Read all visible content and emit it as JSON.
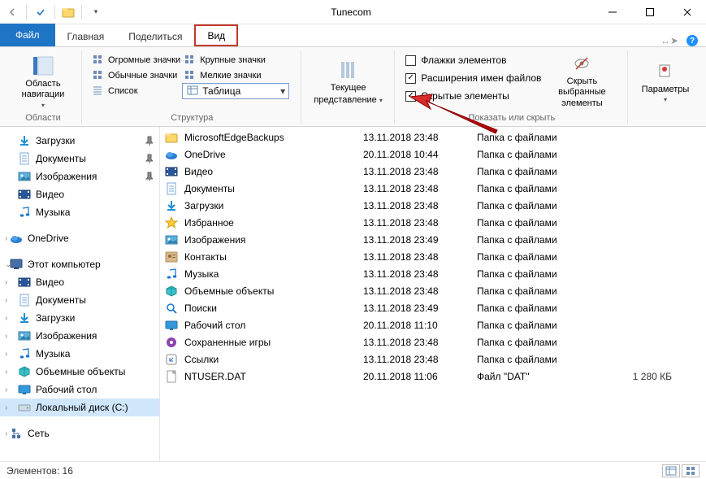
{
  "title": "Tunecom",
  "tabs": {
    "file": "Файл",
    "home": "Главная",
    "share": "Поделиться",
    "view": "Вид"
  },
  "ribbon": {
    "panes": {
      "label": "Область навигации",
      "group": "Области"
    },
    "layout": {
      "huge": "Огромные значки",
      "large": "Крупные значки",
      "normal": "Обычные значки",
      "small": "Мелкие значки",
      "list": "Список",
      "table": "Таблица",
      "group": "Структура"
    },
    "current": {
      "label1": "Текущее",
      "label2": "представление"
    },
    "showhide": {
      "chk1": "Флажки элементов",
      "chk2": "Расширения имен файлов",
      "chk3": "Скрытые элементы",
      "hide1": "Скрыть выбранные",
      "hide2": "элементы",
      "group": "Показать или скрыть"
    },
    "options": "Параметры"
  },
  "nav": {
    "downloads": "Загрузки",
    "documents": "Документы",
    "pictures": "Изображения",
    "videos": "Видео",
    "music": "Музыка",
    "onedrive": "OneDrive",
    "thispc": "Этот компьютер",
    "pc_videos": "Видео",
    "pc_documents": "Документы",
    "pc_downloads": "Загрузки",
    "pc_pictures": "Изображения",
    "pc_music": "Музыка",
    "pc_3d": "Объемные объекты",
    "pc_desktop": "Рабочий стол",
    "pc_localc": "Локальный диск (C:)",
    "network": "Сеть"
  },
  "files": [
    {
      "name": "MicrosoftEdgeBackups",
      "date": "13.11.2018 23:48",
      "type": "Папка с файлами",
      "size": "",
      "icon": "folder"
    },
    {
      "name": "OneDrive",
      "date": "20.11.2018 10:44",
      "type": "Папка с файлами",
      "size": "",
      "icon": "onedrive"
    },
    {
      "name": "Видео",
      "date": "13.11.2018 23:48",
      "type": "Папка с файлами",
      "size": "",
      "icon": "video"
    },
    {
      "name": "Документы",
      "date": "13.11.2018 23:48",
      "type": "Папка с файлами",
      "size": "",
      "icon": "doc"
    },
    {
      "name": "Загрузки",
      "date": "13.11.2018 23:48",
      "type": "Папка с файлами",
      "size": "",
      "icon": "download"
    },
    {
      "name": "Избранное",
      "date": "13.11.2018 23:48",
      "type": "Папка с файлами",
      "size": "",
      "icon": "star"
    },
    {
      "name": "Изображения",
      "date": "13.11.2018 23:49",
      "type": "Папка с файлами",
      "size": "",
      "icon": "pic"
    },
    {
      "name": "Контакты",
      "date": "13.11.2018 23:48",
      "type": "Папка с файлами",
      "size": "",
      "icon": "contact"
    },
    {
      "name": "Музыка",
      "date": "13.11.2018 23:48",
      "type": "Папка с файлами",
      "size": "",
      "icon": "music"
    },
    {
      "name": "Объемные объекты",
      "date": "13.11.2018 23:48",
      "type": "Папка с файлами",
      "size": "",
      "icon": "3d"
    },
    {
      "name": "Поиски",
      "date": "13.11.2018 23:49",
      "type": "Папка с файлами",
      "size": "",
      "icon": "search"
    },
    {
      "name": "Рабочий стол",
      "date": "20.11.2018 11:10",
      "type": "Папка с файлами",
      "size": "",
      "icon": "desktop"
    },
    {
      "name": "Сохраненные игры",
      "date": "13.11.2018 23:48",
      "type": "Папка с файлами",
      "size": "",
      "icon": "games"
    },
    {
      "name": "Ссылки",
      "date": "13.11.2018 23:48",
      "type": "Папка с файлами",
      "size": "",
      "icon": "link"
    },
    {
      "name": "NTUSER.DAT",
      "date": "20.11.2018 11:06",
      "type": "Файл \"DAT\"",
      "size": "1 280 КБ",
      "icon": "file"
    }
  ],
  "status": "Элементов: 16"
}
